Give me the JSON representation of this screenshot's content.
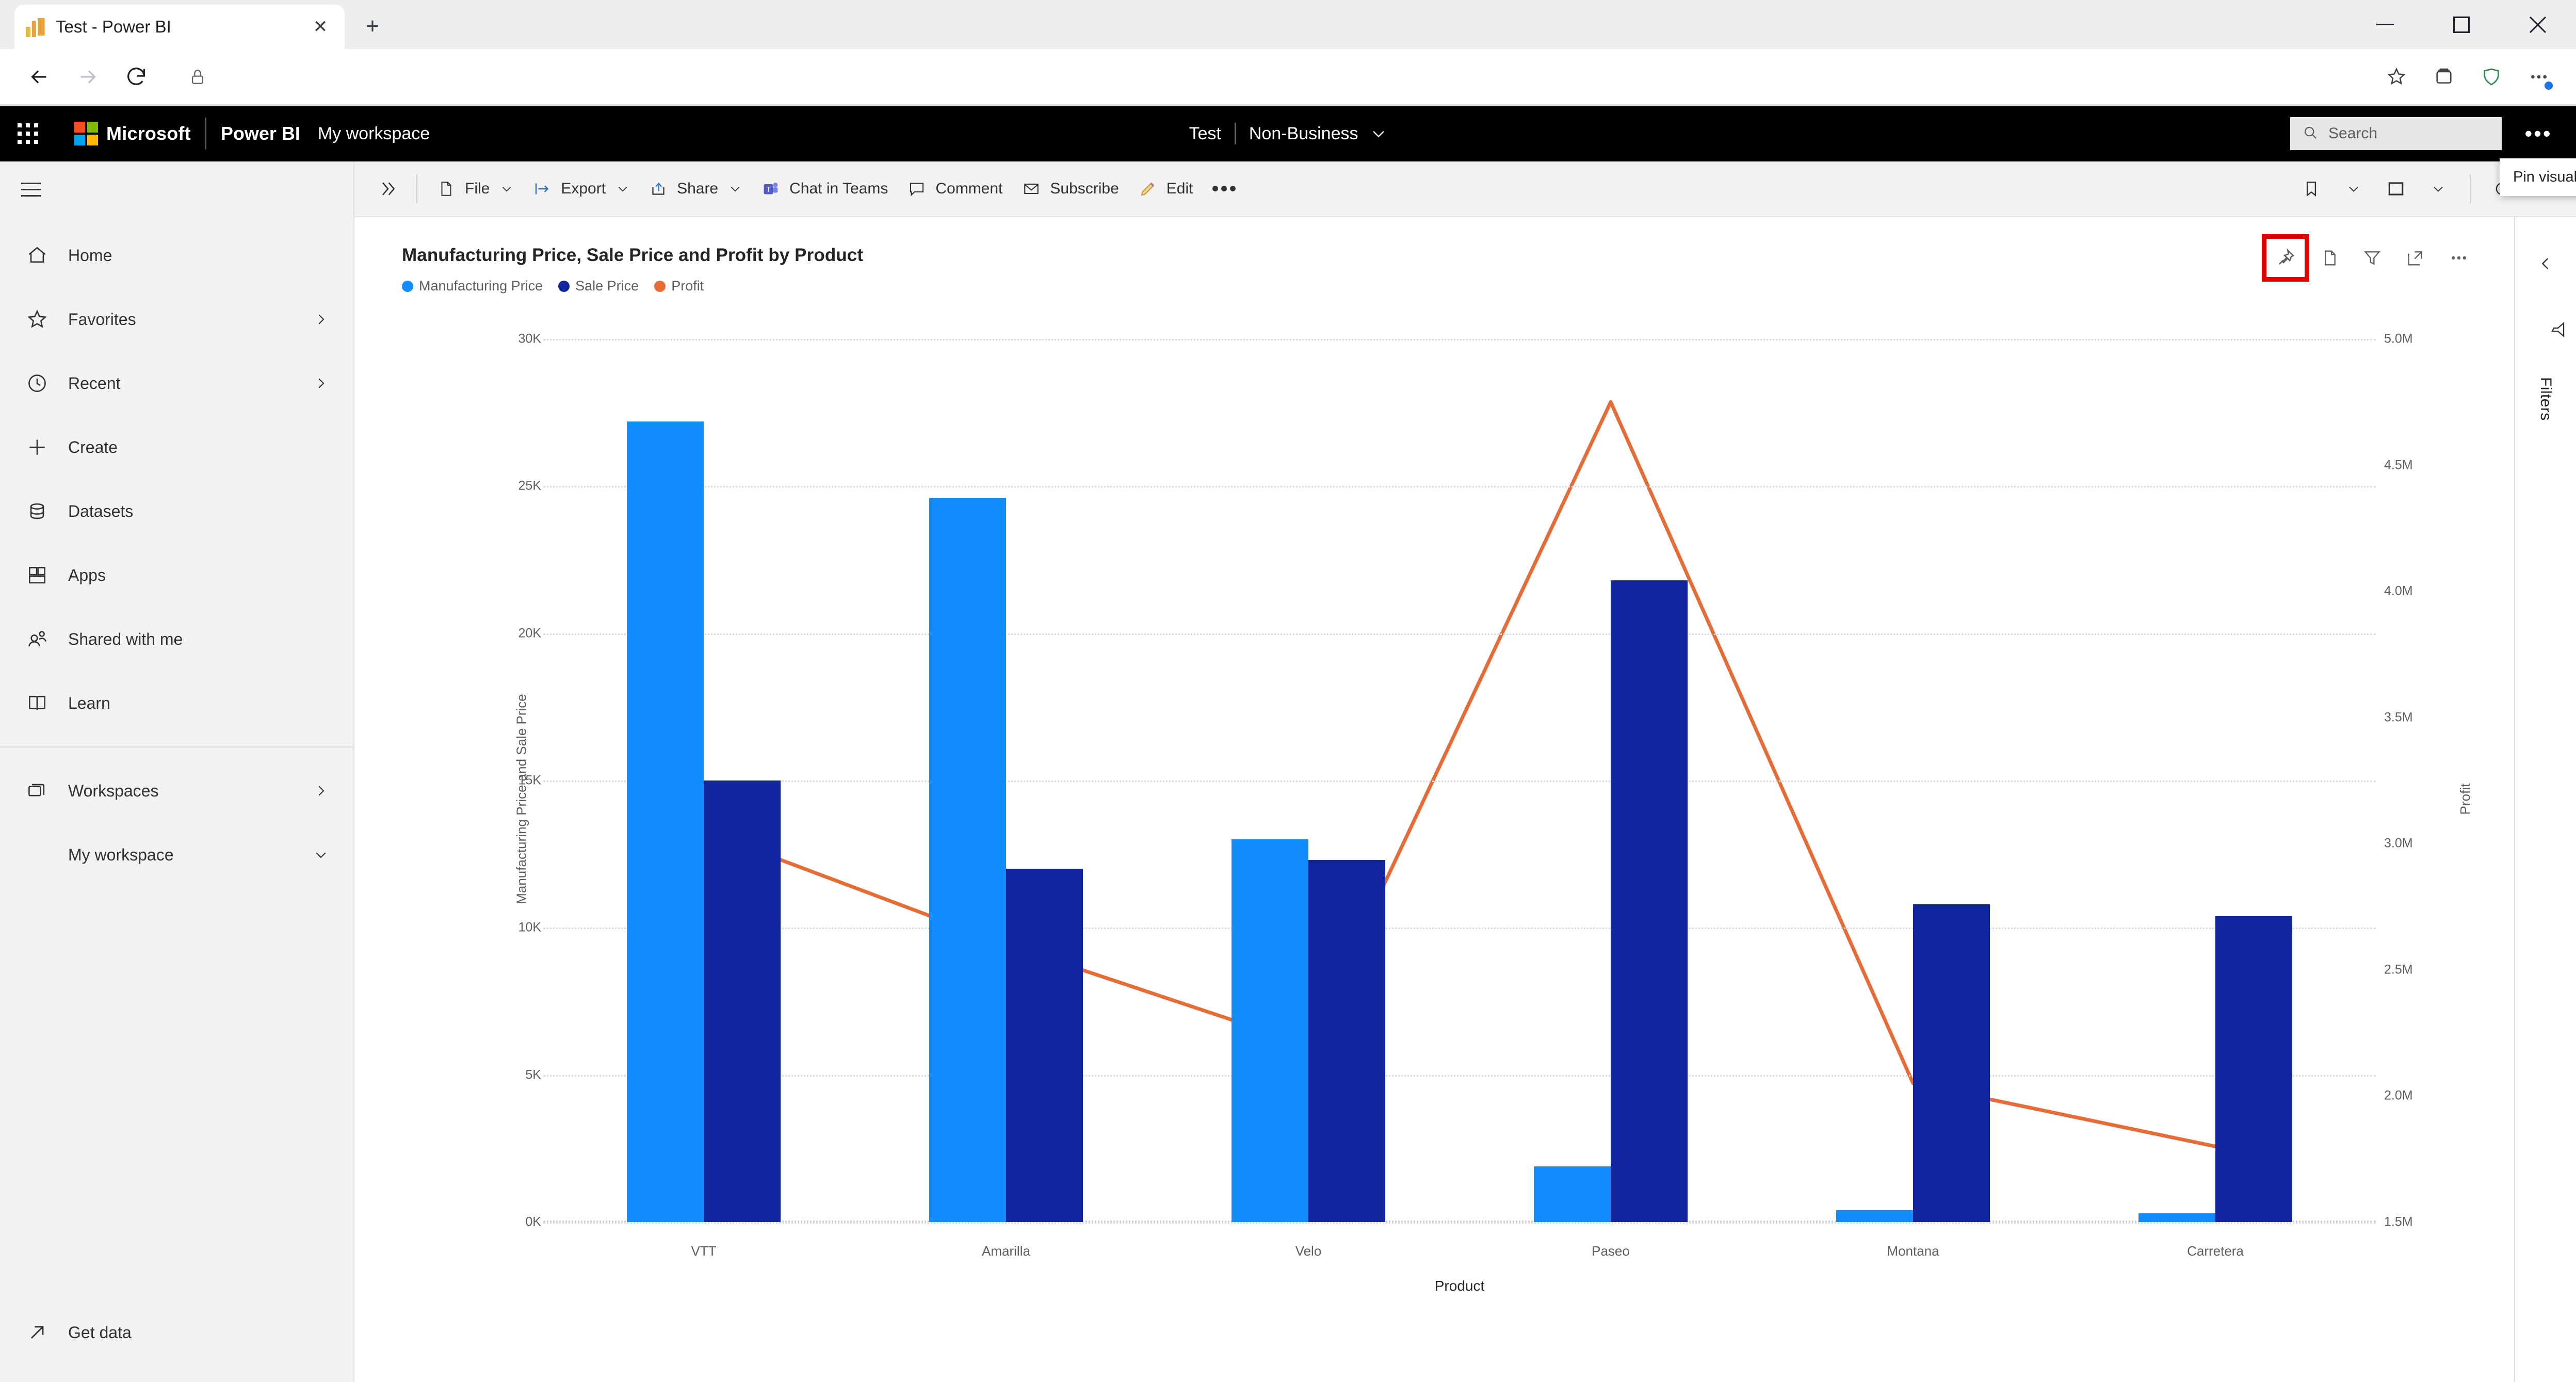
{
  "browser": {
    "tab": {
      "title": "Test - Power BI",
      "favicon": "powerbi-icon",
      "close": "✕"
    },
    "new_tab": "+",
    "window_controls": {
      "minimize": "—",
      "maximize": "❐",
      "close": "✕"
    },
    "nav": {
      "back": "back-arrow",
      "forward": "forward-arrow",
      "reload": "reload-arrow"
    },
    "omnibox": {
      "value": "",
      "placeholder": ""
    },
    "toolbar_icons": [
      "favorite-star-icon",
      "collections-icon",
      "browser-essentials-icon",
      "settings-more-icon"
    ]
  },
  "topbar": {
    "waffle": "app-launcher-icon",
    "microsoft": "Microsoft",
    "product": "Power BI",
    "workspace": "My workspace",
    "report_name": "Test",
    "separator": "|",
    "label_badge": "Non-Business",
    "chevron": "∨",
    "search": {
      "placeholder": "Search",
      "icon": "search-icon"
    },
    "more": "•••"
  },
  "sidebar": {
    "hamburger": "menu-icon",
    "items": [
      {
        "label": "Home",
        "icon": "home-icon",
        "chevron": ""
      },
      {
        "label": "Favorites",
        "icon": "star-icon",
        "chevron": "›"
      },
      {
        "label": "Recent",
        "icon": "clock-icon",
        "chevron": "›"
      },
      {
        "label": "Create",
        "icon": "plus-icon",
        "chevron": ""
      },
      {
        "label": "Datasets",
        "icon": "database-icon",
        "chevron": ""
      },
      {
        "label": "Apps",
        "icon": "apps-grid-icon",
        "chevron": ""
      },
      {
        "label": "Shared with me",
        "icon": "shared-people-icon",
        "chevron": ""
      },
      {
        "label": "Learn",
        "icon": "book-icon",
        "chevron": ""
      }
    ],
    "workspaces": {
      "label": "Workspaces",
      "icon": "workspaces-icon",
      "chevron": "›"
    },
    "my_workspace": {
      "label": "My workspace",
      "chevron": "∨"
    },
    "get_data": {
      "label": "Get data",
      "icon": "get-data-arrow-icon"
    }
  },
  "toolbar": {
    "expand": "»",
    "items": [
      {
        "label": "File",
        "icon": "file-icon",
        "caret": "∨"
      },
      {
        "label": "Export",
        "icon": "export-arrow-icon",
        "caret": "∨"
      },
      {
        "label": "Share",
        "icon": "share-icon",
        "caret": "∨"
      },
      {
        "label": "Chat in Teams",
        "icon": "teams-icon",
        "caret": ""
      },
      {
        "label": "Comment",
        "icon": "comment-icon",
        "caret": ""
      },
      {
        "label": "Subscribe",
        "icon": "envelope-icon",
        "caret": ""
      },
      {
        "label": "Edit",
        "icon": "pencil-icon",
        "caret": ""
      }
    ],
    "more": "•••",
    "right_items": [
      {
        "name": "bookmarks-icon",
        "caret": "∨"
      },
      {
        "name": "view-icon",
        "caret": "∨"
      },
      {
        "name": "refresh-icon",
        "caret": ""
      },
      {
        "name": "favorite-star-icon",
        "caret": ""
      }
    ]
  },
  "tooltip": {
    "text": "Pin visual"
  },
  "visual": {
    "title": "Manufacturing Price, Sale Price and Profit by Product",
    "actions": [
      {
        "name": "pin-visual-icon",
        "highlighted": true
      },
      {
        "name": "copy-visual-icon",
        "highlighted": false
      },
      {
        "name": "filter-icon",
        "highlighted": false
      },
      {
        "name": "focus-mode-icon",
        "highlighted": false
      },
      {
        "name": "more-options-icon",
        "highlighted": false
      }
    ]
  },
  "right_rail": {
    "collapse": "‹",
    "filter_icon": "filter-funnel-icon",
    "label": "Filters"
  },
  "colors": {
    "manufacturing_price": "#118DFF",
    "sale_price": "#12239E",
    "profit": "#E66C37",
    "highlight": "#E00000",
    "topbar_bg": "#000000",
    "sidebar_bg": "#F3F2F1"
  },
  "chart_data": {
    "type": "bar",
    "title": "Manufacturing Price, Sale Price and Profit by Product",
    "xlabel": "Product",
    "ylabel": "Manufacturing Price and Sale Price",
    "y2label": "Profit",
    "categories": [
      "VTT",
      "Amarilla",
      "Velo",
      "Paseo",
      "Montana",
      "Carretera"
    ],
    "grid": true,
    "legend_position": "top-left",
    "ylim": [
      0,
      30000
    ],
    "yticks": [
      0,
      5000,
      10000,
      15000,
      20000,
      25000,
      30000
    ],
    "ytick_labels": [
      "0K",
      "5K",
      "10K",
      "15K",
      "20K",
      "25K",
      "30K"
    ],
    "y2lim": [
      1500000,
      5000000
    ],
    "y2ticks": [
      1500000,
      2000000,
      2500000,
      3000000,
      3500000,
      4000000,
      4500000,
      5000000
    ],
    "y2tick_labels": [
      "1.5M",
      "2.0M",
      "2.5M",
      "3.0M",
      "3.5M",
      "4.0M",
      "4.5M",
      "5.0M"
    ],
    "series": [
      {
        "name": "Manufacturing Price",
        "type": "bar",
        "axis": "left",
        "color": "#118DFF",
        "values": [
          27200,
          24600,
          13000,
          1900,
          400,
          300
        ]
      },
      {
        "name": "Sale Price",
        "type": "bar",
        "axis": "left",
        "color": "#12239E",
        "values": [
          15000,
          12000,
          12300,
          21800,
          10800,
          10400
        ]
      },
      {
        "name": "Profit",
        "type": "line",
        "axis": "right",
        "color": "#E66C37",
        "values": [
          3050000,
          2600000,
          2200000,
          4750000,
          2050000,
          1800000
        ]
      }
    ]
  }
}
